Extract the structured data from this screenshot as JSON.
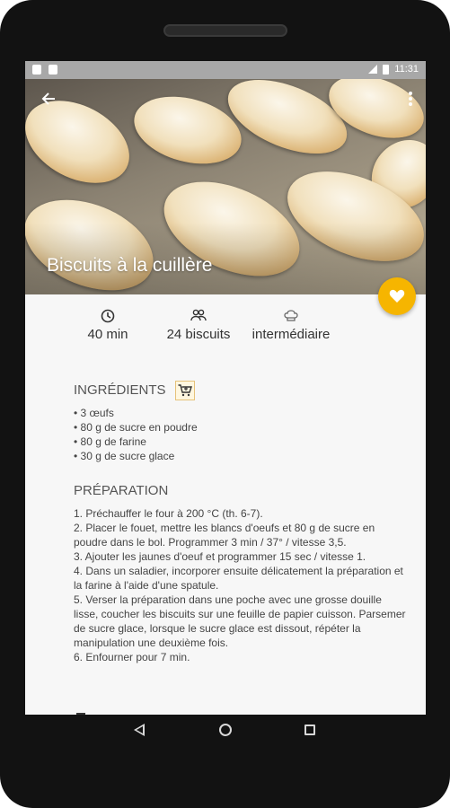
{
  "status_bar": {
    "time": "11:31"
  },
  "recipe": {
    "title": "Biscuits à la cuillère",
    "stats": [
      {
        "icon": "clock-icon",
        "value": "40 min"
      },
      {
        "icon": "people-icon",
        "value": "24 biscuits"
      },
      {
        "icon": "chef-hat-icon",
        "value": "intermédiaire"
      }
    ]
  },
  "ingredients": {
    "title": "INGRÉDIENTS",
    "items": [
      "• 3 œufs",
      "• 80 g de sucre en poudre",
      "• 80 g de farine",
      "• 30 g de sucre glace"
    ]
  },
  "preparation": {
    "title": "PRÉPARATION",
    "steps": [
      "1. Préchauffer le four à 200 °C (th. 6-7).",
      "2. Placer le fouet, mettre les blancs d'oeufs et 80 g de sucre en poudre dans le bol. Programmer 3 min / 37° / vitesse 3,5.",
      "3. Ajouter les jaunes d'oeuf et programmer 15 sec / vitesse 1.",
      "4. Dans un saladier, incorporer ensuite délicatement la préparation et la farine à l'aide d'une spatule.",
      "5. Verser la préparation dans une poche avec une grosse douille lisse, coucher les biscuits sur une feuille de papier cuisson. Parsemer de sucre glace, lorsque le sucre glace est dissout, répéter la manipulation une deuxième fois.",
      "6. Enfourner pour 7 min."
    ]
  },
  "colors": {
    "accent": "#f6b500",
    "status_bar": "#a8a8a8"
  }
}
